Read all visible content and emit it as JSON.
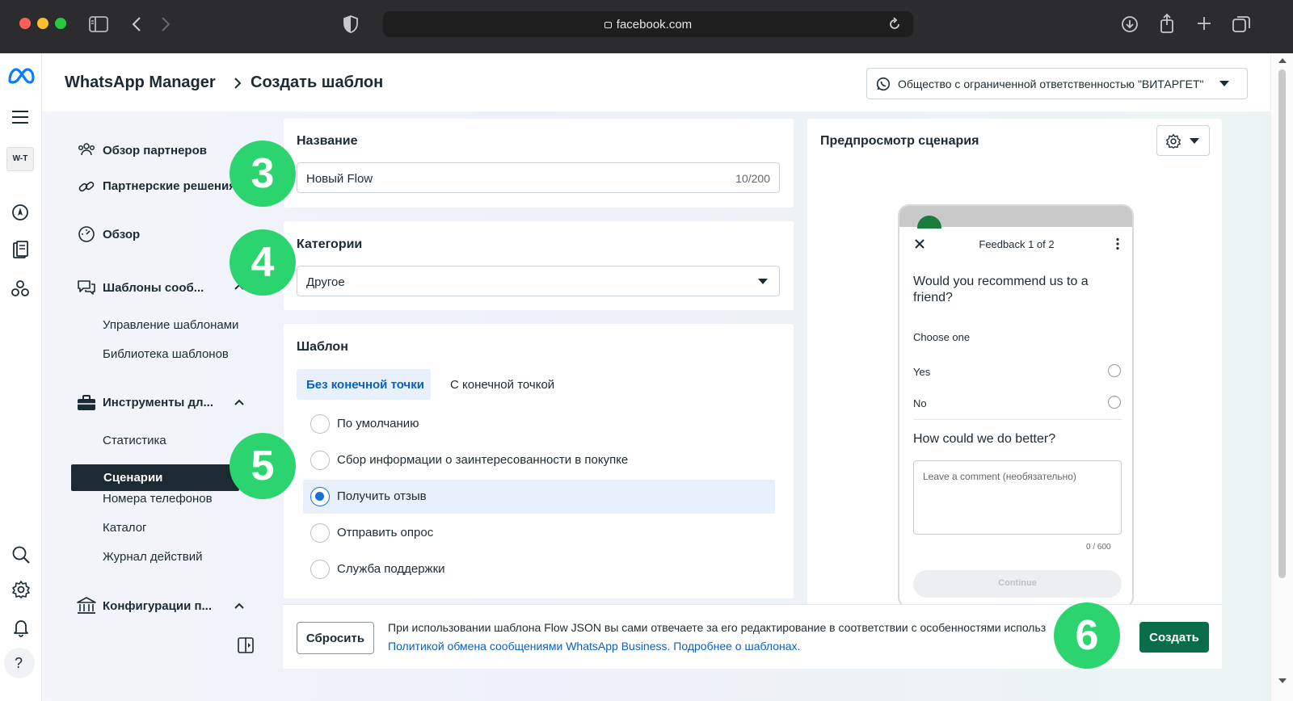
{
  "browser": {
    "url": "facebook.com"
  },
  "header": {
    "app_title": "WhatsApp Manager",
    "page_title": "Создать шаблон",
    "account": "Общество с ограниченной ответственностью \"ВИТАРГЕТ\""
  },
  "rail": {
    "brand_logo": "W-T"
  },
  "sidebar": {
    "partners_overview": "Обзор партнеров",
    "partner_solutions": "Партнерские решения",
    "overview": "Обзор",
    "templates_section": "Шаблоны сооб...",
    "manage_templates": "Управление шаблонами",
    "template_library": "Библиотека шаблонов",
    "tools_section": "Инструменты дл...",
    "statistics": "Статистика",
    "flows": "Сценарии",
    "phone_numbers": "Номера телефонов",
    "catalog": "Каталог",
    "activity_log": "Журнал действий",
    "config_section": "Конфигурации п..."
  },
  "form": {
    "name_label": "Название",
    "name_value": "Новый Flow",
    "name_count": "10/200",
    "category_label": "Категории",
    "category_value": "Другое",
    "template_label": "Шаблон",
    "tab_no_endpoint": "Без конечной точки",
    "tab_with_endpoint": "С конечной точкой",
    "options": [
      "По умолчанию",
      "Сбор информации о заинтересованности в покупке",
      "Получить отзыв",
      "Отправить опрос",
      "Служба поддержки"
    ],
    "selected_option": "Получить отзыв"
  },
  "preview": {
    "title": "Предпросмотр сценария",
    "screen_title": "Feedback 1 of 2",
    "question1": "Would you recommend us to a friend?",
    "choose_one": "Choose one",
    "opt_yes": "Yes",
    "opt_no": "No",
    "question2": "How could we do better?",
    "comment_placeholder": "Leave a comment (необязательно)",
    "counter": "0 / 600",
    "continue_label": "Continue"
  },
  "footer": {
    "reset_label": "Сбросить",
    "notice": "При использовании шаблона Flow JSON вы сами отвечаете за его редактирование в соответствии с особенностями использ",
    "policy_link": "Политикой обмена сообщениями WhatsApp Business.",
    "learn_more_link": "Подробнее о шаблонах.",
    "create_label": "Создать"
  },
  "badges": {
    "b3": "3",
    "b4": "4",
    "b5": "5",
    "b6": "6"
  },
  "colors": {
    "accent_blue": "#0a5fbf",
    "create_green": "#0a6d4a",
    "badge_green": "#2bd46f",
    "sidebar_selected": "#1c2b33"
  }
}
